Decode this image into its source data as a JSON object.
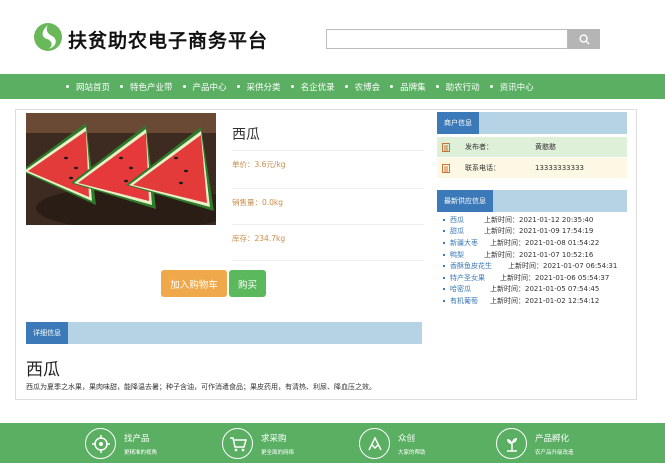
{
  "header": {
    "title": "扶贫助农电子商务平台",
    "search_placeholder": "",
    "search_value": ""
  },
  "nav": {
    "items": [
      {
        "label": "网站首页"
      },
      {
        "label": "特色产业带"
      },
      {
        "label": "产品中心"
      },
      {
        "label": "采供分类"
      },
      {
        "label": "名企优录"
      },
      {
        "label": "农博会"
      },
      {
        "label": "品牌集"
      },
      {
        "label": "助农行动"
      },
      {
        "label": "资讯中心"
      }
    ]
  },
  "product": {
    "name": "西瓜",
    "price": "单价：3.6元/kg",
    "sales": "销售量：0.0kg",
    "stock": "库存：234.7kg",
    "add_to_cart": "加入购物车",
    "buy": "购买"
  },
  "detail": {
    "tab": "详细信息",
    "title": "西瓜",
    "description": "西瓜为夏季之水果，果肉味甜，能降温去暑；种子含油，可作消遣食品；果皮药用，有清热、利尿、降血压之效。"
  },
  "merchant": {
    "tab": "商户信息",
    "publisher_label": "发布者：",
    "publisher": "黄憨憨",
    "phone_label": "联系电话：",
    "phone": "13333333333"
  },
  "supply": {
    "tab": "最新供应信息",
    "items": [
      {
        "name": "西瓜",
        "time": "上新时间：2021-01-12 20:35:40"
      },
      {
        "name": "甜瓜",
        "time": "上新时间：2021-01-09 17:54:19"
      },
      {
        "name": "新疆大枣",
        "time": "上新时间：2021-01-08 01:54:22"
      },
      {
        "name": "鸭梨",
        "time": "上新时间：2021-01-07 10:52:16"
      },
      {
        "name": "香酥鱼皮花生",
        "time": "上新时间：2021-01-07 06:54:31"
      },
      {
        "name": "特产圣女果",
        "time": "上新时间：2021-01-06 05:54:37"
      },
      {
        "name": "哈密瓜",
        "time": "上新时间：2021-01-05 07:54:45"
      },
      {
        "name": "有机葡萄",
        "time": "上新时间：2021-01-02 12:54:12"
      }
    ]
  },
  "footer": {
    "items": [
      {
        "title": "找产品",
        "sub": "更精准的视角",
        "icon": "target-icon"
      },
      {
        "title": "求采购",
        "sub": "更全面的网络",
        "icon": "cart-icon"
      },
      {
        "title": "众创",
        "sub": "大家的帮助",
        "icon": "handshake-icon"
      },
      {
        "title": "产品孵化",
        "sub": "农产品升级改造",
        "icon": "incubate-icon"
      }
    ]
  },
  "colors": {
    "green": "#5aaf63",
    "blue_tab": "#3b79b8",
    "light_blue_bar": "#b6d3e6",
    "orange": "#f0a94a",
    "price_text": "#c98d4a"
  }
}
